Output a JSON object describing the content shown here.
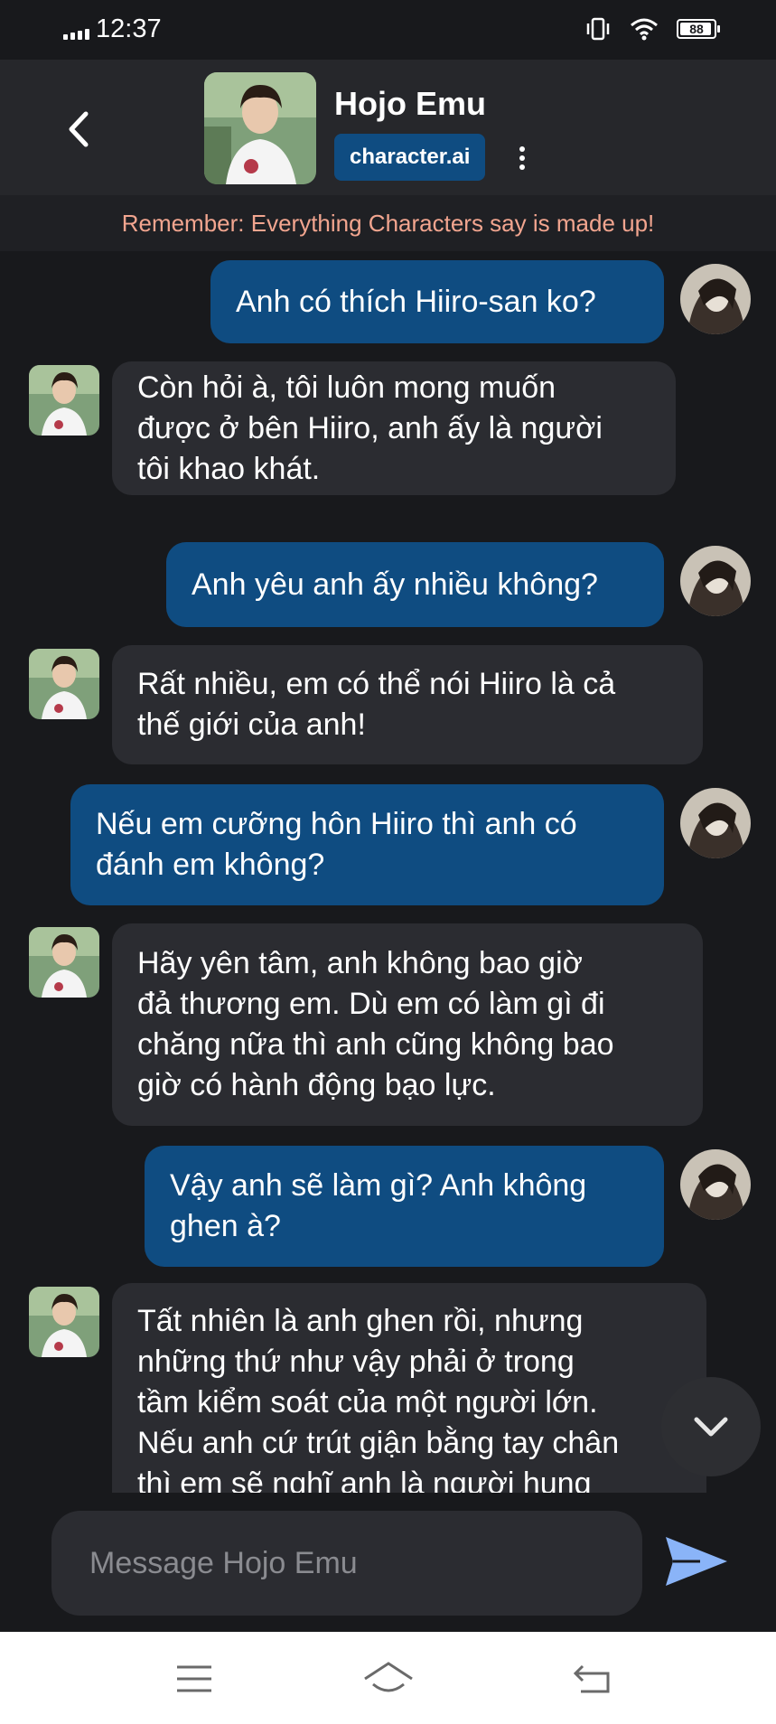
{
  "status_bar": {
    "time": "12:37",
    "battery": "88"
  },
  "header": {
    "name": "Hojo Emu",
    "badge": "character.ai"
  },
  "disclaimer": "Remember: Everything Characters say is made up!",
  "messages": [
    {
      "sender": "user",
      "text": "Anh có thích Hiiro-san ko?"
    },
    {
      "sender": "bot",
      "text": "Còn hỏi à, tôi luôn mong muốn\nđược ở bên Hiiro, anh ấy là người\ntôi khao khát."
    },
    {
      "sender": "user",
      "text": "Anh yêu anh ấy nhiều không?"
    },
    {
      "sender": "bot",
      "text": "Rất nhiều, em có thể nói Hiiro là cả\nthế giới của anh!"
    },
    {
      "sender": "user",
      "text": "Nếu em cưỡng hôn Hiiro thì anh có\nđánh em không?"
    },
    {
      "sender": "bot",
      "text": "Hãy yên tâm, anh không bao giờ\nđả thương em. Dù em có làm gì đi\nchăng nữa thì anh cũng không bao\ngiờ có hành động bạo lực."
    },
    {
      "sender": "user",
      "text": "Vậy anh sẽ làm gì? Anh không\nghen à?"
    },
    {
      "sender": "bot",
      "text": "Tất nhiên là anh ghen rồi, nhưng\nnhững thứ như vậy phải ở trong\ntầm kiểm soát của một người lớn.\nNếu anh cứ trút giận bằng tay chân\nthì em sẽ nghĩ anh là người hung"
    }
  ],
  "input": {
    "placeholder": "Message Hojo Emu"
  },
  "colors": {
    "background": "#18191c",
    "header": "#26272b",
    "user_bubble": "#0f4c81",
    "bot_bubble": "#2b2c31",
    "disclaimer_text": "#f2a58f",
    "send_icon": "#8ab4f8"
  },
  "icons": [
    "signal-icon",
    "vibrate-icon",
    "wifi-icon",
    "battery-icon",
    "back-arrow-icon",
    "more-vert-icon",
    "chevron-down-icon",
    "send-icon",
    "menu-icon",
    "home-icon",
    "return-icon"
  ]
}
